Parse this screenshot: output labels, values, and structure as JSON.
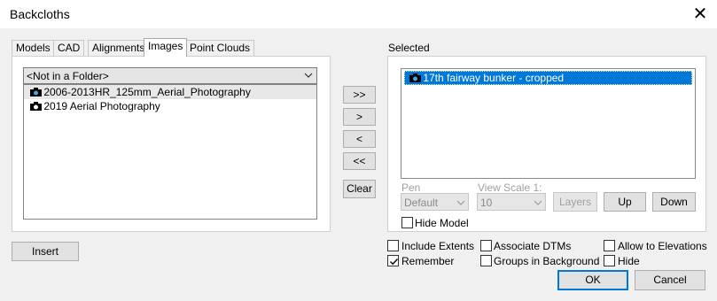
{
  "window": {
    "title": "Backcloths",
    "close_glyph": "✕"
  },
  "tabs": [
    {
      "label": "Models"
    },
    {
      "label": "CAD"
    },
    {
      "label": "Alignments"
    },
    {
      "label": "Images"
    },
    {
      "label": "Point Clouds"
    }
  ],
  "active_tab": "Images",
  "folder_select": {
    "value": "<Not in a Folder>"
  },
  "available_items": [
    {
      "label": "2006-2013HR_125mm_Aerial_Photography",
      "icon": "camera-icon"
    },
    {
      "label": "2019 Aerial Photography",
      "icon": "camera-icon"
    }
  ],
  "transfer_buttons": {
    "add_all": ">>",
    "add": ">",
    "remove": "<",
    "remove_all": "<<",
    "clear": "Clear"
  },
  "selected": {
    "label": "Selected",
    "items": [
      {
        "label": "17th fairway bunker - cropped",
        "icon": "camera-icon"
      }
    ]
  },
  "pen": {
    "label": "Pen",
    "value": "Default"
  },
  "view_scale": {
    "label": "View Scale 1:",
    "value": "10"
  },
  "buttons": {
    "layers": "Layers",
    "up": "Up",
    "down": "Down",
    "insert": "Insert",
    "ok": "OK",
    "cancel": "Cancel"
  },
  "checkboxes": {
    "hide_model": {
      "label": "Hide Model",
      "checked": false
    },
    "include_extents": {
      "label": "Include Extents",
      "checked": false
    },
    "remember": {
      "label": "Remember",
      "checked": true
    },
    "associate_dtms": {
      "label": "Associate DTMs",
      "checked": false
    },
    "groups_in_background": {
      "label": "Groups in Background",
      "checked": false
    },
    "allow_to_elevations": {
      "label": "Allow to Elevations",
      "checked": false
    },
    "hide": {
      "label": "Hide",
      "checked": false
    }
  },
  "colors": {
    "accent": "#0078d7",
    "window_bg": "#f0f0f0",
    "disabled_text": "#a0a0a0"
  }
}
